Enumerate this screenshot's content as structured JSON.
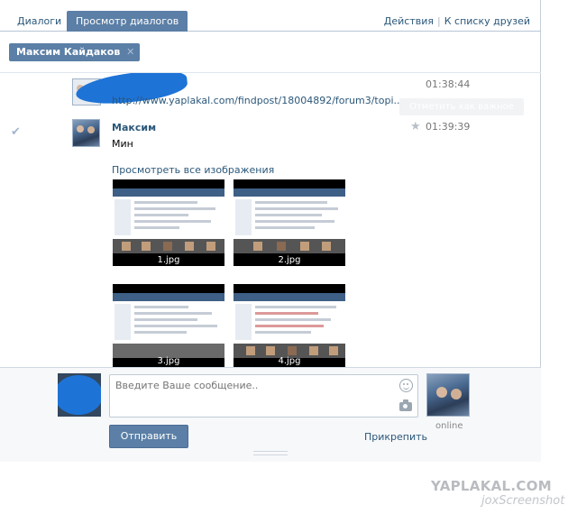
{
  "tabs": {
    "dialogs": "Диалоги",
    "view_dialogs": "Просмотр диалогов"
  },
  "top_links": {
    "actions": "Действия",
    "separator": "|",
    "friends_list": "К списку друзей"
  },
  "recipient_chip": {
    "name": "Максим Кайдаков",
    "close": "✕"
  },
  "messages": [
    {
      "link": "http://www.yaplakal.com/findpost/18004892/forum3/topi..",
      "time": "01:38:44",
      "mark_important": "Отметить как важное"
    },
    {
      "sender": "Максим",
      "text": "Мин",
      "time": "01:39:39",
      "see_all_images": "Просмотреть все изображения",
      "images": [
        "1.jpg",
        "2.jpg",
        "3.jpg",
        "4.jpg"
      ]
    }
  ],
  "composer": {
    "placeholder": "Введите Ваше сообщение..",
    "send": "Отправить",
    "attach": "Прикрепить",
    "status": "online"
  },
  "watermark": {
    "brand": "YAPLAKAL.COM",
    "tool": "joxScreenshot"
  },
  "colors": {
    "accent": "#5b7fa6",
    "link": "#2b587a",
    "avatar_blob": "#1e73d6"
  }
}
